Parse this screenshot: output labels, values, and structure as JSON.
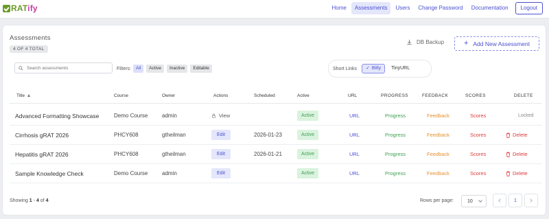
{
  "app": {
    "logo_prefix": "g",
    "logo_text": "RAT",
    "logo_suffix": "ify",
    "brand_color": "#6b9b29",
    "accent_color": "#4b4fd1"
  },
  "nav": {
    "items": [
      {
        "label": "Home"
      },
      {
        "label": "Assessments"
      },
      {
        "label": "Users"
      },
      {
        "label": "Change Password"
      },
      {
        "label": "Documentation"
      }
    ],
    "active_index": 1,
    "logout_label": "Logout"
  },
  "page": {
    "title": "Assessments",
    "total_badge": "4 OF 4 TOTAL",
    "db_backup_label": "DB Backup",
    "add_button_label": "Add New Assessment"
  },
  "search": {
    "placeholder": "Search assessments",
    "value": ""
  },
  "filters": {
    "label": "Filters:",
    "options": [
      "All",
      "Active",
      "Inactive",
      "Editable"
    ],
    "selected": "All"
  },
  "short_links": {
    "label": "Short Links",
    "options": [
      "Bitly",
      "TinyURL"
    ],
    "selected": "Bitly"
  },
  "table": {
    "headers": {
      "title": "Title",
      "course": "Course",
      "owner": "Owner",
      "actions": "Actions",
      "scheduled": "Scheduled",
      "active": "Active",
      "url": "URL",
      "progress": "PROGRESS",
      "feedback": "FEEDBACK",
      "scores": "SCORES",
      "delete": "DELETE"
    },
    "rows": [
      {
        "title": "Advanced Formatting Showcase",
        "course": "Demo Course",
        "owner": "admin",
        "action": "View",
        "scheduled": "",
        "active": "Active",
        "url": "URL",
        "progress": "Progress",
        "feedback": "Feedback",
        "scores": "Scores",
        "delete": "Locked"
      },
      {
        "title": "Cirrhosis gRAT 2026",
        "course": "PHCY608",
        "owner": "gtheilman",
        "action": "Edit",
        "scheduled": "2026-01-23",
        "active": "Active",
        "url": "URL",
        "progress": "Progress",
        "feedback": "Feedback",
        "scores": "Scores",
        "delete": "Delete"
      },
      {
        "title": "Hepatitis gRAT 2026",
        "course": "PHCY608",
        "owner": "gtheilman",
        "action": "Edit",
        "scheduled": "2026-01-21",
        "active": "Active",
        "url": "URL",
        "progress": "Progress",
        "feedback": "Feedback",
        "scores": "Scores",
        "delete": "Delete"
      },
      {
        "title": "Sample Knowledge Check",
        "course": "Demo Course",
        "owner": "admin",
        "action": "Edit",
        "scheduled": "",
        "active": "Active",
        "url": "URL",
        "progress": "Progress",
        "feedback": "Feedback",
        "scores": "Scores",
        "delete": "Delete"
      }
    ]
  },
  "footer": {
    "showing_prefix": "Showing ",
    "showing_range_start": "1",
    "showing_dash": " - ",
    "showing_range_end": "4",
    "showing_of": " of ",
    "showing_total": "4",
    "rows_per_page_label": "Rows per page:",
    "rows_per_page_value": "10",
    "current_page": "1"
  }
}
